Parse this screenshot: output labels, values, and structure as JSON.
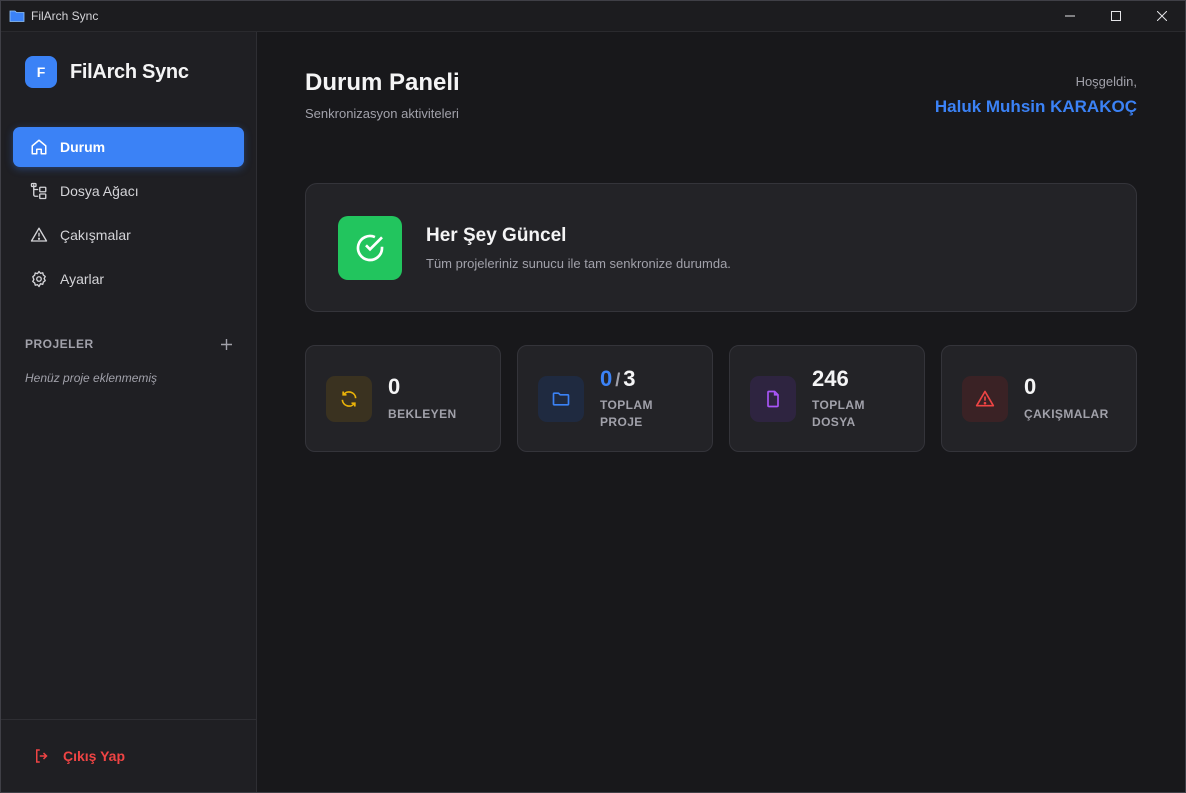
{
  "window": {
    "title": "FilArch Sync"
  },
  "sidebar": {
    "brand_badge": "F",
    "brand_name": "FilArch Sync",
    "items": [
      {
        "label": "Durum",
        "icon": "home-icon",
        "active": true
      },
      {
        "label": "Dosya Ağacı",
        "icon": "tree-icon"
      },
      {
        "label": "Çakışmalar",
        "icon": "warning-icon"
      },
      {
        "label": "Ayarlar",
        "icon": "gear-icon"
      }
    ],
    "projects_title": "PROJELER",
    "projects_empty": "Henüz proje eklenmemiş",
    "logout": "Çıkış Yap"
  },
  "header": {
    "title": "Durum Paneli",
    "subtitle": "Senkronizasyon aktiviteleri",
    "welcome_label": "Hoşgeldin,",
    "user_name": "Haluk Muhsin KARAKOÇ"
  },
  "status": {
    "title": "Her Şey Güncel",
    "description": "Tüm projeleriniz sunucu ile tam senkronize durumda."
  },
  "stats": [
    {
      "value": "0",
      "label": "BEKLEYEN",
      "icon": "sync-icon",
      "color": "#eab308"
    },
    {
      "value_current": "0",
      "value_sep": "/",
      "value_total": "3",
      "label": "TOPLAM PROJE",
      "icon": "folder-icon",
      "color": "#3b82f6"
    },
    {
      "value": "246",
      "label": "TOPLAM DOSYA",
      "icon": "file-icon",
      "color": "#a855f7"
    },
    {
      "value": "0",
      "label": "ÇAKIŞMALAR",
      "icon": "alert-icon",
      "color": "#ef4444"
    }
  ],
  "colors": {
    "accent": "#3b82f6",
    "success": "#22c55e",
    "danger": "#ef4444",
    "background": "#18181b",
    "sidebar": "#1f1f23"
  }
}
